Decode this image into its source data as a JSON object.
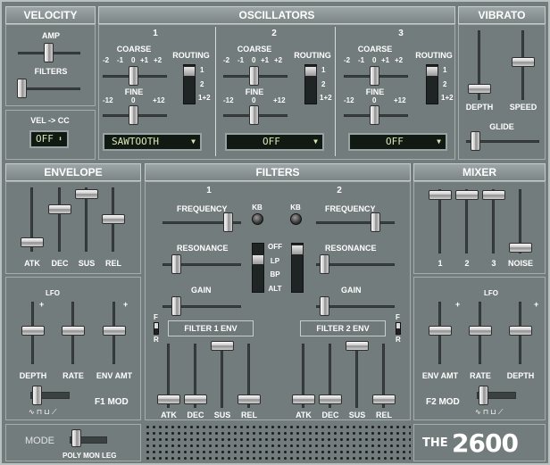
{
  "velocity": {
    "title": "VELOCITY",
    "amp": "AMP",
    "filters": "FILTERS"
  },
  "velcc": {
    "title": "VEL -> CC",
    "value": "OFF"
  },
  "oscillators": {
    "title": "OSCILLATORS",
    "coarse": "COARSE",
    "fine": "FINE",
    "routing": "ROUTING",
    "coarse_ticks": [
      "-2",
      "-1",
      "0",
      "+1",
      "+2"
    ],
    "fine_ticks": [
      "-12",
      "0",
      "+12"
    ],
    "routing_ticks": [
      "1",
      "2",
      "1+2"
    ],
    "osc": [
      {
        "num": "1",
        "wave": "SAWTOOTH"
      },
      {
        "num": "2",
        "wave": "OFF"
      },
      {
        "num": "3",
        "wave": "OFF"
      }
    ]
  },
  "vibrato": {
    "title": "VIBRATO",
    "depth": "DEPTH",
    "speed": "SPEED",
    "glide": "GLIDE"
  },
  "envelope": {
    "title": "ENVELOPE",
    "atk": "ATK",
    "dec": "DEC",
    "sus": "SUS",
    "rel": "REL"
  },
  "filters": {
    "title": "FILTERS",
    "f1": {
      "num": "1",
      "frequency": "FREQUENCY",
      "resonance": "RESONANCE",
      "gain": "GAIN",
      "kb": "KB",
      "env": "FILTER 1 ENV"
    },
    "f2": {
      "num": "2",
      "frequency": "FREQUENCY",
      "resonance": "RESONANCE",
      "gain": "GAIN",
      "kb": "KB",
      "env": "FILTER 2 ENV"
    },
    "types": [
      "OFF",
      "LP",
      "BP",
      "ALT"
    ],
    "fr": [
      "F",
      "R"
    ],
    "env_labels": [
      "ATK",
      "DEC",
      "SUS",
      "REL"
    ]
  },
  "mixer": {
    "title": "MIXER",
    "labels": [
      "1",
      "2",
      "3",
      "NOISE"
    ]
  },
  "f1mod": {
    "lfo": "LFO",
    "depth": "DEPTH",
    "rate": "RATE",
    "envamt": "ENV AMT",
    "name": "F1 MOD",
    "plus": "+",
    "minus": "-"
  },
  "f2mod": {
    "lfo": "LFO",
    "envamt": "ENV AMT",
    "rate": "RATE",
    "depth": "DEPTH",
    "name": "F2 MOD",
    "plus": "+",
    "minus": "-"
  },
  "mode": {
    "title": "MODE",
    "options": "POLY MON LEG"
  },
  "logo": {
    "the": "THE",
    "num": "2600"
  }
}
